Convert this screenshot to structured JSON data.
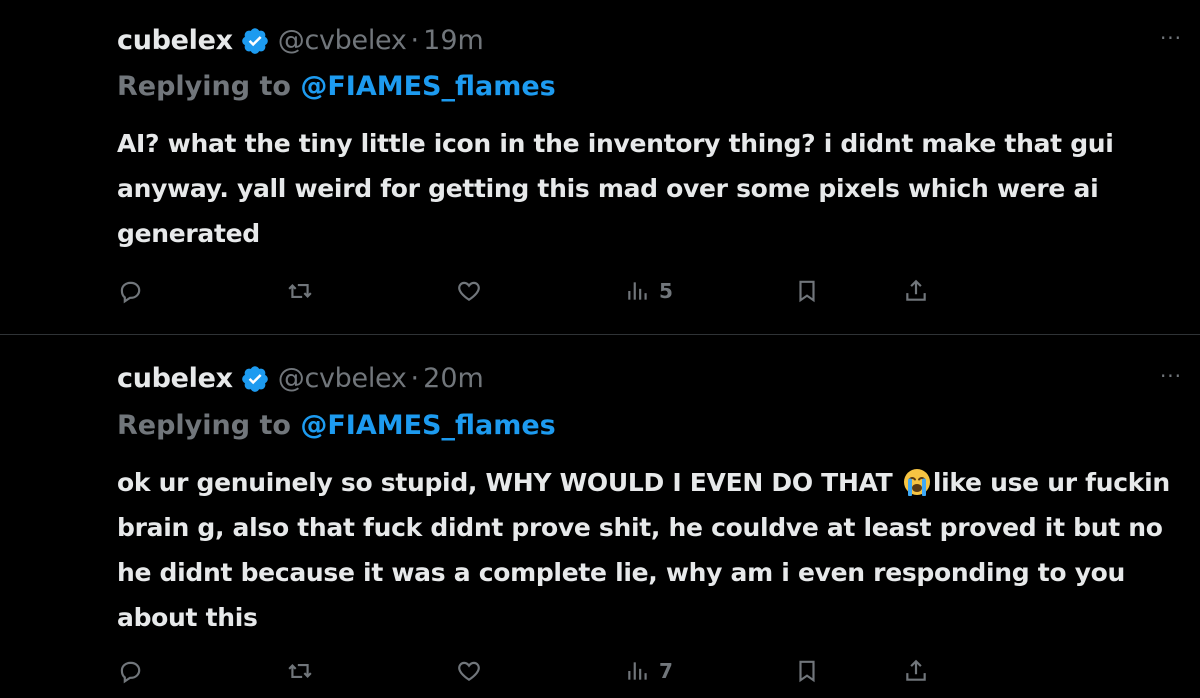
{
  "colors": {
    "background": "#000000",
    "text": "#e7e9ea",
    "muted": "#71767b",
    "accent": "#1d9bf0",
    "divider": "#2f3336"
  },
  "tweets": [
    {
      "display_name": "cubelex",
      "verified_icon": "verified-badge-icon",
      "handle": "@cvbelex",
      "separator": "·",
      "time": "19m",
      "replying_prefix": "Replying to ",
      "replying_to": "@FIAMES_flames",
      "text": "AI? what the tiny little icon in the inventory thing? i didnt make that gui anyway. yall weird for getting this mad over some pixels which were ai generated",
      "more_label": "···",
      "actions": {
        "reply_icon": "reply-icon",
        "retweet_icon": "retweet-icon",
        "like_icon": "heart-icon",
        "views_icon": "views-chart-icon",
        "views_count": "5",
        "bookmark_icon": "bookmark-icon",
        "share_icon": "share-icon"
      }
    },
    {
      "display_name": "cubelex",
      "verified_icon": "verified-badge-icon",
      "handle": "@cvbelex",
      "separator": "·",
      "time": "20m",
      "replying_prefix": "Replying to ",
      "replying_to": "@FIAMES_flames",
      "text_before_emoji": "ok ur genuinely so stupid, WHY WOULD I EVEN DO THAT ",
      "emoji": "loudly-crying-face-emoji",
      "text_after_emoji": "like use ur fuckin brain g, also that fuck didnt prove shit, he couldve at least proved it but no he didnt because it was a complete lie, why am i even responding to you about this",
      "more_label": "···",
      "actions": {
        "reply_icon": "reply-icon",
        "retweet_icon": "retweet-icon",
        "like_icon": "heart-icon",
        "views_icon": "views-chart-icon",
        "views_count": "7",
        "bookmark_icon": "bookmark-icon",
        "share_icon": "share-icon"
      }
    }
  ]
}
